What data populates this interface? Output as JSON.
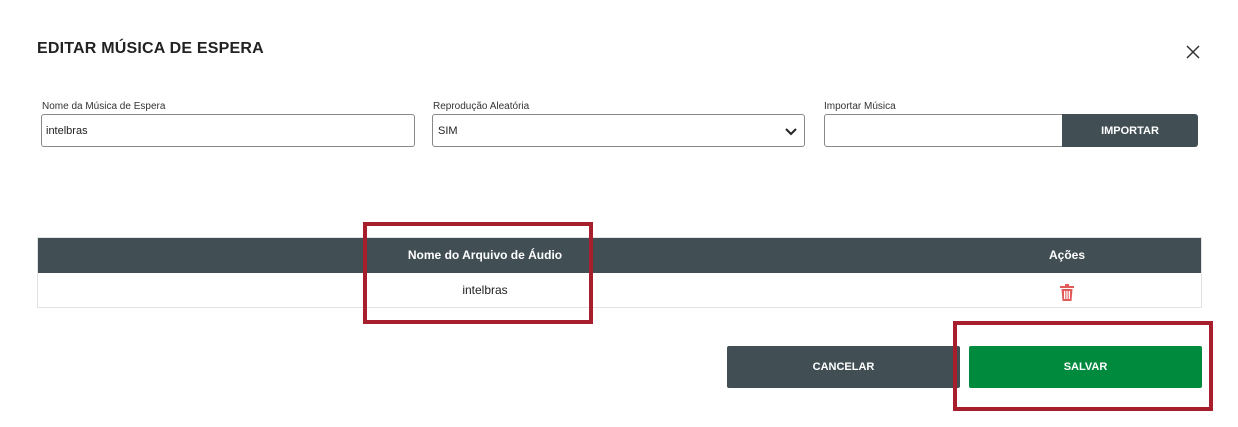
{
  "dialog": {
    "title": "EDITAR MÚSICA DE ESPERA",
    "close_icon": "close-icon"
  },
  "form": {
    "name": {
      "label": "Nome da Música de Espera",
      "value": "intelbras"
    },
    "shuffle": {
      "label": "Reprodução Aleatória",
      "value": "SIM",
      "icon": "chevron-down-icon"
    },
    "import": {
      "label": "Importar Música",
      "value": "",
      "button_label": "IMPORTAR"
    }
  },
  "table": {
    "columns": [
      "Nome do Arquivo de Áudio",
      "Ações"
    ],
    "rows": [
      {
        "file_name": "intelbras",
        "action_icon": "trash-icon"
      }
    ]
  },
  "footer": {
    "cancel_label": "CANCELAR",
    "save_label": "SALVAR"
  },
  "colors": {
    "header_bg": "#414f55",
    "save_green": "#008a3d",
    "delete_red": "#e05a5a",
    "highlight_red": "#a71e2d"
  }
}
